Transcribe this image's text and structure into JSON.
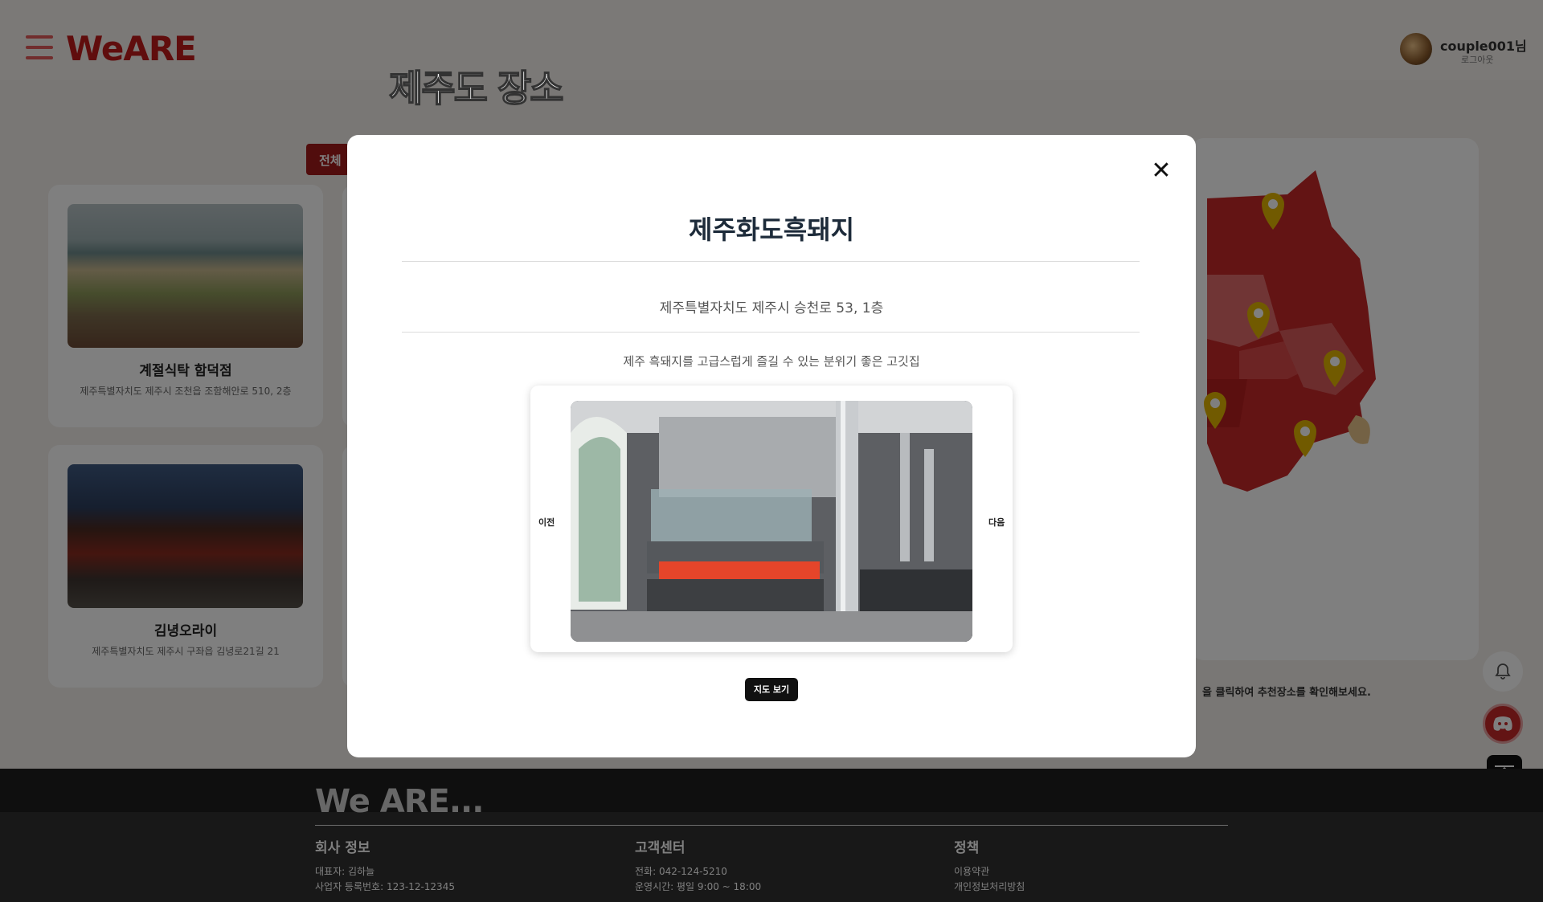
{
  "header": {
    "logo": "WeARE",
    "username": "couple001님",
    "logout": "로그아웃"
  },
  "page": {
    "title": "제주도 장소",
    "filter_label": "전체",
    "map_hint": "을 클릭하여 추천장소를 확인해보세요."
  },
  "places": [
    {
      "name": "계절식탁 함덕점",
      "address": "제주특별자치도 제주시 조천읍 조함해안로 510, 2층"
    },
    {
      "name": "김녕오라이",
      "address": "제주특별자치도 제주시 구좌읍 김녕로21길 21"
    }
  ],
  "modal": {
    "close": "✕",
    "title": "제주화도흑돼지",
    "address": "제주특별자치도 제주시 승천로 53, 1층",
    "description": "제주 흑돼지를 고급스럽게 즐길 수 있는 분위기 좋은 고깃집",
    "prev": "이전",
    "next": "다음",
    "map_button": "지도 보기"
  },
  "footer": {
    "brand": "We ARE...",
    "company": {
      "heading": "회사 정보",
      "ceo": "대표자: 김하늘",
      "reg": "사업자 등록번호: 123-12-12345"
    },
    "support": {
      "heading": "고객센터",
      "phone": "전화: 042-124-5210",
      "hours": "운영시간: 평일 9:00 ~ 18:00"
    },
    "policy": {
      "heading": "정책",
      "terms": "이용약관",
      "privacy": "개인정보처리방침"
    }
  },
  "icons": [
    "hamburger-icon",
    "avatar",
    "bell-icon",
    "discord-icon",
    "scroll-top-icon",
    "map-pin-icon",
    "close-icon"
  ],
  "colors": {
    "brand": "#c11b1b",
    "map_dark": "#c62828",
    "map_light": "#e06a6a",
    "pin": "#e2b400",
    "overlay": "rgba(0,0,0,0.5)"
  }
}
